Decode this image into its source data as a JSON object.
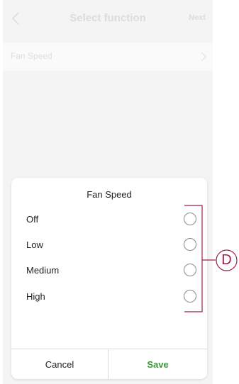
{
  "header": {
    "title": "Select function",
    "next_label": "Next"
  },
  "function_row": {
    "label": "Fan Speed"
  },
  "sheet": {
    "title": "Fan Speed",
    "options": [
      {
        "label": "Off",
        "selected": false
      },
      {
        "label": "Low",
        "selected": false
      },
      {
        "label": "Medium",
        "selected": false
      },
      {
        "label": "High",
        "selected": false
      }
    ],
    "cancel_label": "Cancel",
    "save_label": "Save"
  },
  "callout": {
    "letter": "D"
  },
  "colors": {
    "accent_save": "#3a9a3a",
    "callout": "#9b1e4e",
    "background": "#f4f4f4"
  }
}
